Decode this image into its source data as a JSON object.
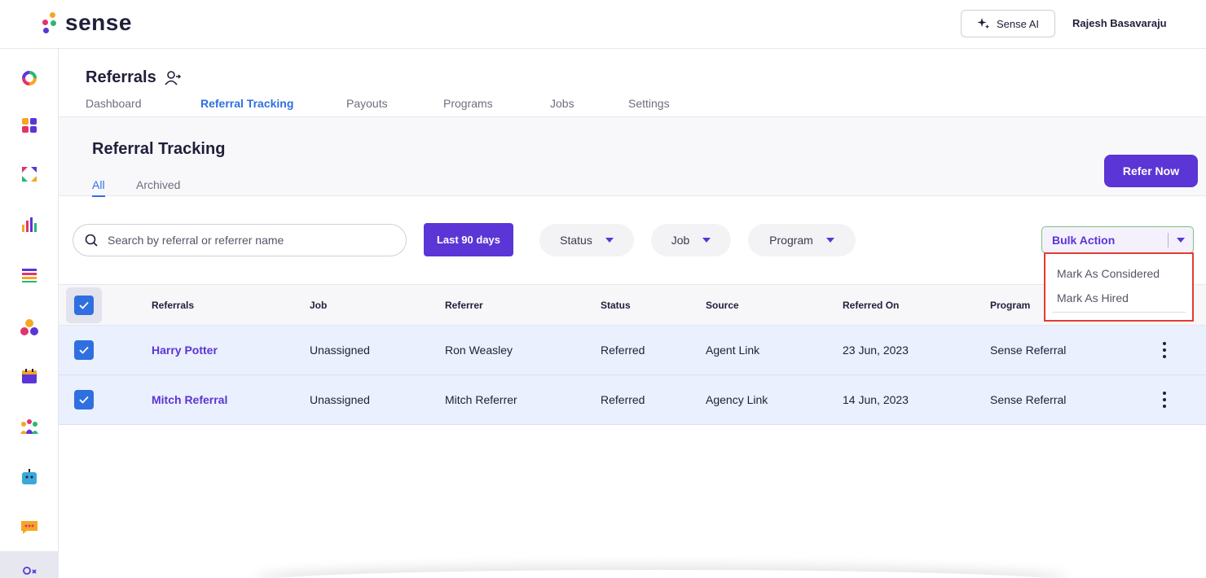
{
  "brand": {
    "name": "sense"
  },
  "header": {
    "ai_button": "Sense AI",
    "user_name": "Rajesh Basavaraju"
  },
  "sidebar": {
    "icons": [
      "ring-logo-icon",
      "apps-grid-icon",
      "arrows-icon",
      "bar-chart-icon",
      "list-icon",
      "nodes-icon",
      "calendar-icon",
      "people-icon",
      "bot-icon",
      "chat-icon",
      "referrals-icon"
    ]
  },
  "page": {
    "title": "Referrals",
    "tabs": [
      "Dashboard",
      "Referral Tracking",
      "Payouts",
      "Programs",
      "Jobs",
      "Settings"
    ],
    "active_tab": "Referral Tracking"
  },
  "panel": {
    "title": "Referral Tracking",
    "sub_tabs": [
      "All",
      "Archived"
    ],
    "refer_button": "Refer Now"
  },
  "filters": {
    "search_placeholder": "Search by referral or referrer name",
    "date_button": "Last 90 days",
    "status": "Status",
    "job": "Job",
    "program": "Program"
  },
  "bulk_action": {
    "label": "Bulk Action",
    "options": [
      "Mark As Considered",
      "Mark As Hired"
    ]
  },
  "table": {
    "columns": [
      "Referrals",
      "Job",
      "Referrer",
      "Status",
      "Source",
      "Referred On",
      "Program"
    ],
    "rows": [
      {
        "referral": "Harry Potter",
        "job": "Unassigned",
        "referrer": "Ron Weasley",
        "status": "Referred",
        "source": "Agent Link",
        "referred_on": "23 Jun, 2023",
        "program": "Sense Referral"
      },
      {
        "referral": "Mitch Referral",
        "job": "Unassigned",
        "referrer": "Mitch Referrer",
        "status": "Referred",
        "source": "Agency Link",
        "referred_on": "14 Jun, 2023",
        "program": "Sense Referral"
      }
    ]
  },
  "colors": {
    "primary": "#5b35d5",
    "link": "#2f6fe0",
    "highlight_border": "#e53b30",
    "row_selected": "#eaf0fd"
  }
}
